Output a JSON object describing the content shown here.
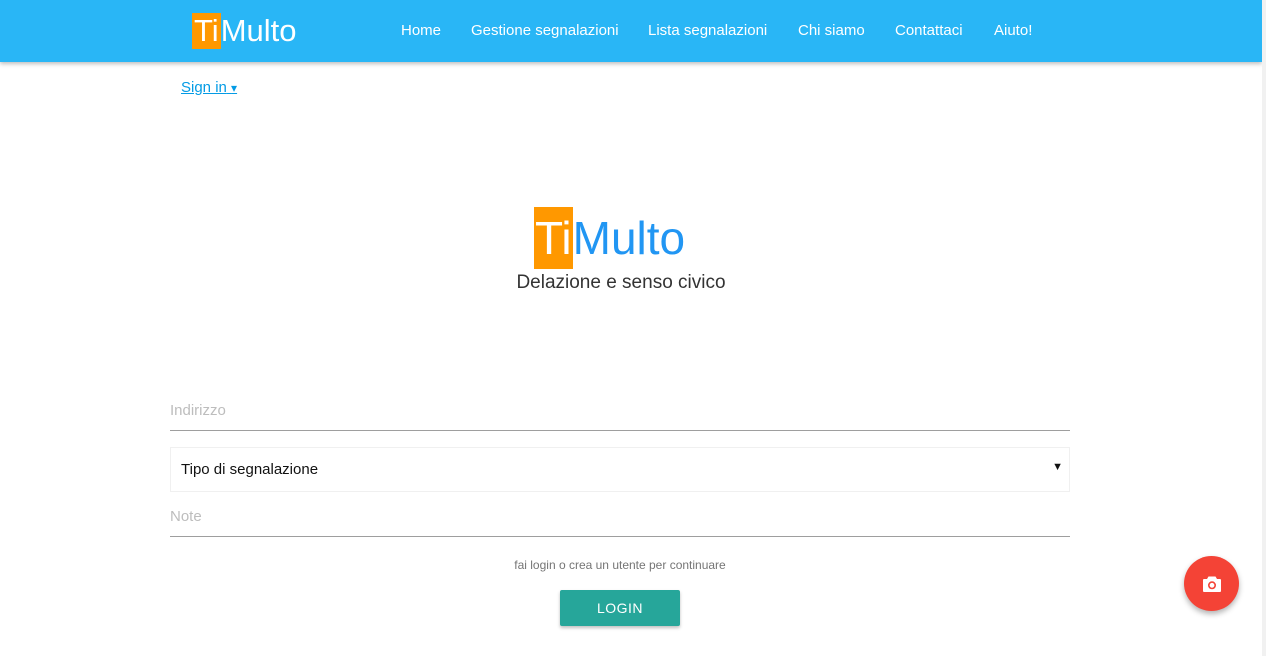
{
  "brand": {
    "prefix": "Ti",
    "suffix": "Multo"
  },
  "nav": {
    "items": [
      {
        "label": "Home"
      },
      {
        "label": "Gestione segnalazioni"
      },
      {
        "label": "Lista segnalazioni"
      },
      {
        "label": "Chi siamo"
      },
      {
        "label": "Contattaci"
      },
      {
        "label": "Aiuto!"
      }
    ]
  },
  "signin": {
    "label": "Sign in",
    "caret": "▾"
  },
  "hero": {
    "prefix": "Ti",
    "suffix": "Multo",
    "tagline": "Delazione e senso civico"
  },
  "form": {
    "address_placeholder": "Indirizzo",
    "address_value": "",
    "type_selected": "Tipo di segnalazione",
    "type_arrow": "▼",
    "note_placeholder": "Note",
    "note_value": "",
    "hint": "fai login o crea un utente per continuare",
    "login_label": "LOGIN"
  },
  "fab": {
    "icon": "camera-icon"
  },
  "colors": {
    "navbar": "#29b6f6",
    "brand_accent": "#ff9800",
    "hero_text": "#2196f3",
    "link": "#039be5",
    "login_button": "#26a69a",
    "fab": "#f44336"
  }
}
